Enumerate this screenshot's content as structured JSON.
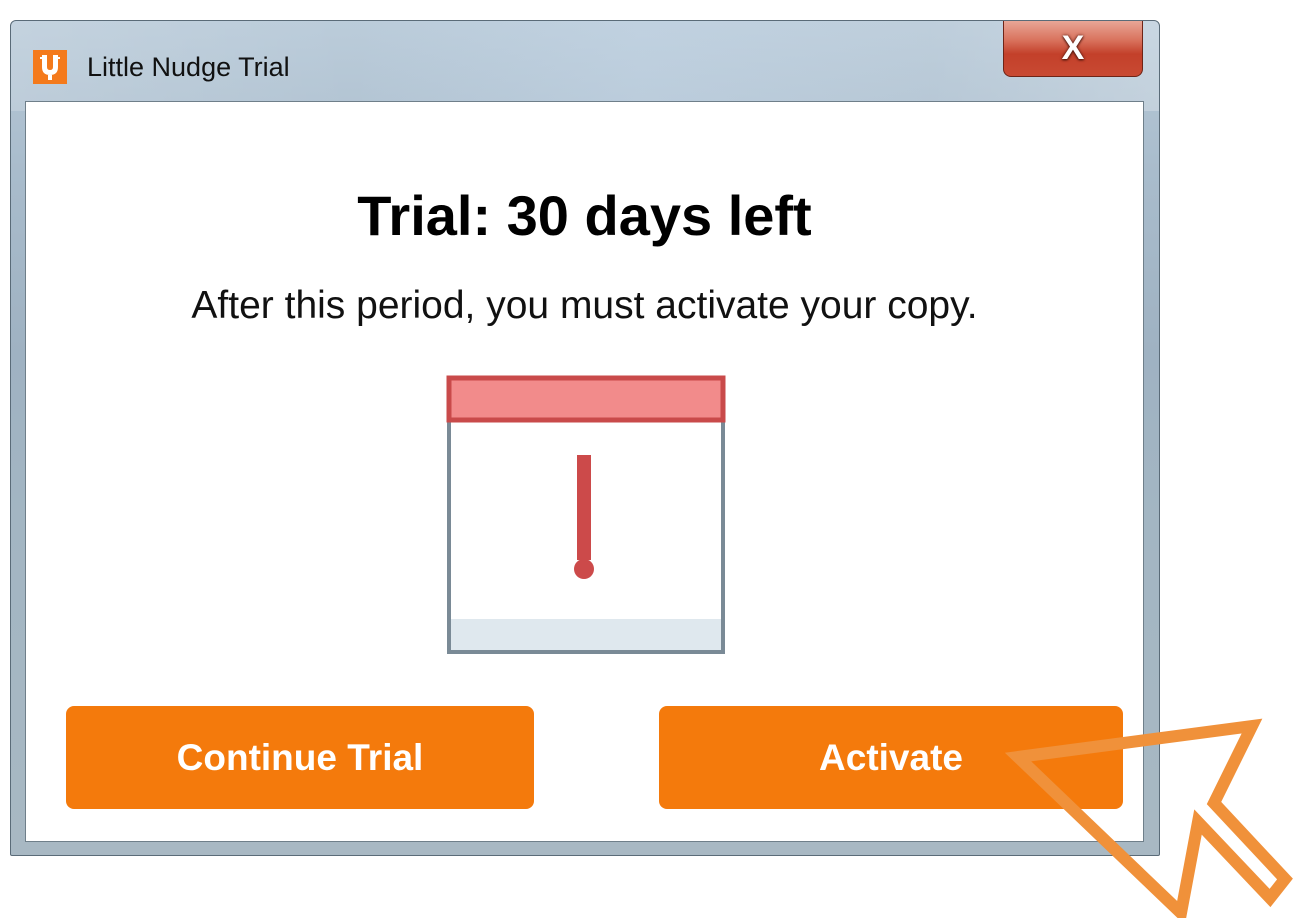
{
  "window": {
    "title": "Little Nudge Trial",
    "close_glyph": "X",
    "app_icon": "little-nudge-app-icon",
    "app_icon_color": "#f47a1c"
  },
  "dialog": {
    "heading": "Trial: 30 days left",
    "message": "After this period, you must activate your copy.",
    "illustration_icon": "calendar-warning-icon",
    "illustration_colors": {
      "header": "#f28b8b",
      "header_border": "#c94a4a",
      "body_border": "#7a8a96",
      "exclamation": "#cc4a4a",
      "footer": "#dfe8ee"
    }
  },
  "buttons": {
    "continue_label": "Continue Trial",
    "activate_label": "Activate",
    "accent_color": "#f47a0c"
  },
  "annotation": {
    "icon": "pointer-arrow-annotation",
    "color": "#f0913a"
  }
}
